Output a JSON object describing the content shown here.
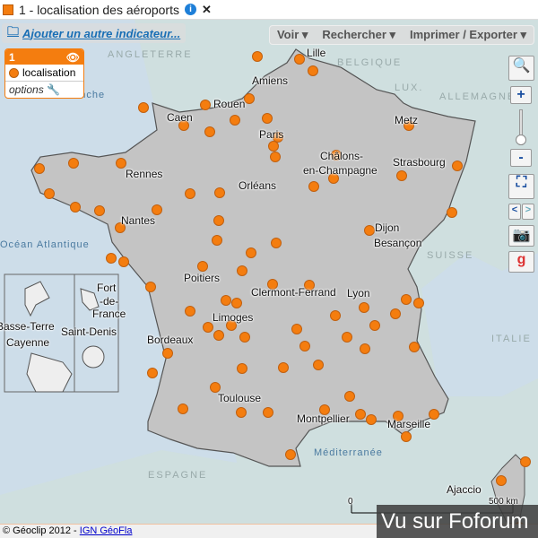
{
  "title": "1 - localisation des aéroports",
  "add_indicator": "Ajouter un autre indicateur...",
  "legend": {
    "number": "1",
    "item": "localisation",
    "options": "options"
  },
  "menu": {
    "voir": "Voir",
    "rechercher": "Rechercher",
    "imprimer": "Imprimer / Exporter"
  },
  "toolbar": {
    "zoom_in": "+",
    "zoom_out": "-",
    "prev": "<",
    "next": ">"
  },
  "cities": [
    "Lille",
    "Amiens",
    "Rouen",
    "Caen",
    "Paris",
    "Metz",
    "Châlons-",
    "en-Champagne",
    "Strasbourg",
    "Rennes",
    "Orléans",
    "Nantes",
    "Dijon",
    "Besançon",
    "Poitiers",
    "Clermont-Ferrand",
    "Lyon",
    "Limoges",
    "Bordeaux",
    "Toulouse",
    "Montpellier",
    "Marseille",
    "Ajaccio",
    "Fort",
    "-de-",
    "France",
    "Basse-Terre",
    "Saint-Denis",
    "Cayenne"
  ],
  "countries": [
    "BELGIQUE",
    "ALLEMAGNE",
    "LUX.",
    "SUISSE",
    "ITALIE",
    "ESPAGNE",
    "ANGLETERRE"
  ],
  "seas": [
    "Manche",
    "Océan Atlantique",
    "Méditerranée"
  ],
  "scale": {
    "start": "0",
    "end": "500 km"
  },
  "footer": {
    "copyright": "© Géoclip 2012 - ",
    "link": "IGN GéoFla"
  },
  "watermark": "Vu sur Foforum",
  "colors": {
    "marker": "#f47d0f",
    "land": "#c8c8c8",
    "sea": "#cddde9"
  }
}
